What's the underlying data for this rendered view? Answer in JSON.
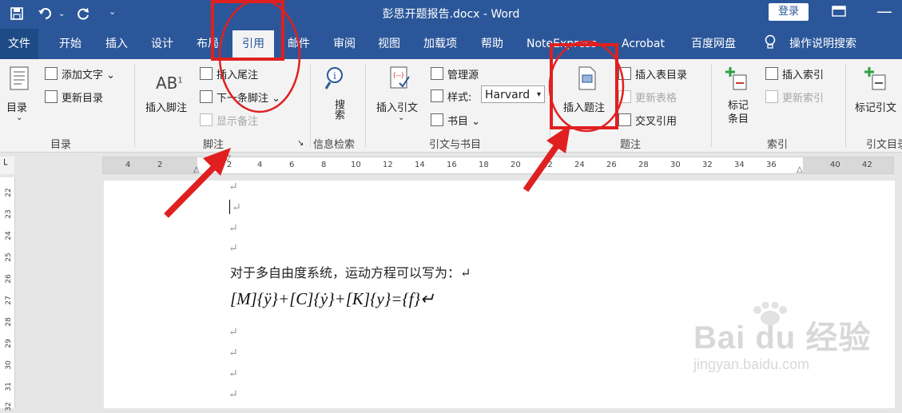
{
  "window": {
    "title": "彭思开题报告.docx  -  Word",
    "login_label": "登录"
  },
  "qat": {
    "save_icon": "save-icon",
    "undo_icon": "undo-icon",
    "redo_icon": "redo-icon",
    "customize_icon": "customize-icon"
  },
  "tabs": [
    {
      "label": "文件"
    },
    {
      "label": "开始"
    },
    {
      "label": "插入"
    },
    {
      "label": "设计"
    },
    {
      "label": "布局"
    },
    {
      "label": "引用"
    },
    {
      "label": "邮件"
    },
    {
      "label": "审阅"
    },
    {
      "label": "视图"
    },
    {
      "label": "加载项"
    },
    {
      "label": "帮助"
    },
    {
      "label": "NoteExpress"
    },
    {
      "label": "Acrobat"
    },
    {
      "label": "百度网盘"
    },
    {
      "label": "操作说明搜索"
    }
  ],
  "ribbon": {
    "toc": {
      "label": "目录",
      "add_text": "添加文字",
      "update_toc": "更新目录",
      "group": "目录"
    },
    "footnotes": {
      "insert_footnote": "插入脚注",
      "insert_endnote": "插入尾注",
      "next_footnote": "下一条脚注",
      "show_notes": "显示备注",
      "group": "脚注"
    },
    "research": {
      "search": "搜索",
      "group": "信息检索"
    },
    "citations": {
      "insert_citation": "插入引文",
      "manage_sources": "管理源",
      "style_label": "样式:",
      "style_value": "Harvard",
      "bibliography": "书目",
      "group": "引文与书目"
    },
    "captions": {
      "insert_caption": "插入题注",
      "insert_table_of_figures": "插入表目录",
      "update_table": "更新表格",
      "cross_reference": "交叉引用",
      "group": "题注"
    },
    "index": {
      "mark_entry": "标记条目",
      "insert_index": "插入索引",
      "update_index": "更新索引",
      "group": "索引"
    },
    "toa": {
      "mark_citation": "标记引文",
      "group": "引文目录"
    }
  },
  "ruler": {
    "ticks": [
      "4",
      "2",
      "2",
      "4",
      "6",
      "8",
      "10",
      "12",
      "14",
      "16",
      "18",
      "20",
      "22",
      "24",
      "26",
      "28",
      "30",
      "32",
      "34",
      "36",
      "40",
      "42"
    ]
  },
  "vruler": {
    "ticks": [
      "22",
      "23",
      "24",
      "25",
      "26",
      "27",
      "28",
      "29",
      "30",
      "31",
      "32"
    ]
  },
  "document": {
    "paragraph_mark": "↵",
    "text": "对于多自由度系统，运动方程可以写为：↵",
    "equation": "[M]{ÿ}+[C]{ẏ}+[K]{y}={f}↵"
  },
  "watermark": {
    "brand": "Bai du 经验",
    "url": "jingyan.baidu.com"
  },
  "colors": {
    "title_blue": "#2b579a",
    "annotation_red": "#e02020"
  }
}
